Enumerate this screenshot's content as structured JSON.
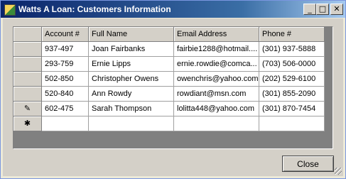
{
  "window": {
    "title": "Watts A Loan: Customers Information",
    "minimize_glyph": "_",
    "maximize_glyph": "□",
    "close_glyph": "✕"
  },
  "grid": {
    "columns": [
      "Account #",
      "Full Name",
      "Email Address",
      "Phone #"
    ],
    "rows": [
      [
        "937-497",
        "Joan Fairbanks",
        "fairbie1288@hotmail....",
        "(301) 937-5888"
      ],
      [
        "293-759",
        "Ernie Lipps",
        "ernie.rowdie@comca...",
        "(703) 506-0000"
      ],
      [
        "502-850",
        "Christopher Owens",
        "owenchris@yahoo.com",
        "(202) 529-6100"
      ],
      [
        "520-840",
        "Ann Rowdy",
        "rowdiant@msn.com",
        "(301) 855-2090"
      ],
      [
        "602-475",
        "Sarah Thompson",
        "lolitta448@yahoo.com",
        "(301) 870-7454"
      ],
      [
        "",
        "",
        "",
        ""
      ]
    ],
    "row_markers": [
      "",
      "",
      "",
      "",
      "✎",
      "✱"
    ]
  },
  "buttons": {
    "close_label": "Close"
  }
}
